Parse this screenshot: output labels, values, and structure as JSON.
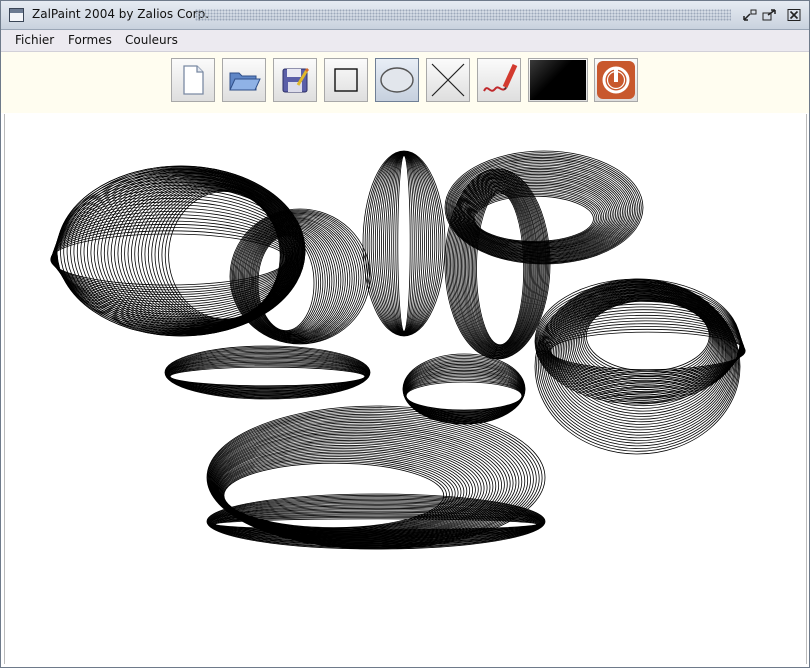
{
  "window": {
    "title": "ZalPaint 2004 by Zalios Corp."
  },
  "menu": [
    {
      "label": "Fichier"
    },
    {
      "label": "Formes"
    },
    {
      "label": "Couleurs"
    }
  ],
  "toolbar": {
    "tools": [
      {
        "name": "new-file-icon"
      },
      {
        "name": "open-folder-icon"
      },
      {
        "name": "save-disk-icon"
      },
      {
        "name": "rectangle-icon"
      },
      {
        "name": "ellipse-icon",
        "selected": true
      },
      {
        "name": "line-icon"
      },
      {
        "name": "freehand-pencil-icon"
      },
      {
        "name": "color-swatch-icon",
        "color": "#000000"
      },
      {
        "name": "power-icon",
        "color": "#c8582d"
      }
    ]
  },
  "titlebar_buttons": [
    "minimize-icon",
    "maximize-icon",
    "close-icon"
  ]
}
